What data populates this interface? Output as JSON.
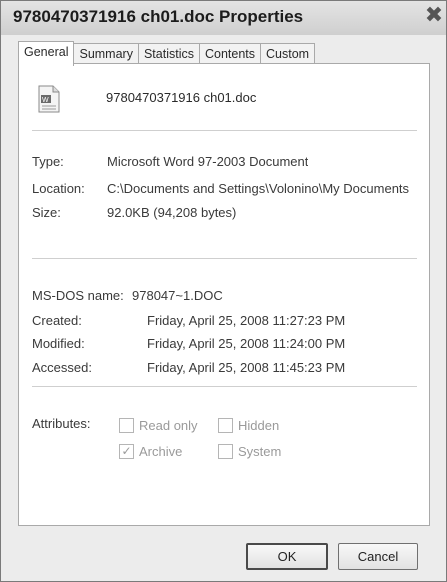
{
  "window": {
    "title": "9780470371916 ch01.doc Properties",
    "close_glyph": "✖"
  },
  "tabs": [
    {
      "label": "General",
      "active": true
    },
    {
      "label": "Summary",
      "active": false
    },
    {
      "label": "Statistics",
      "active": false
    },
    {
      "label": "Contents",
      "active": false
    },
    {
      "label": "Custom",
      "active": false
    }
  ],
  "file": {
    "name": "9780470371916 ch01.doc",
    "icon": "word-document-icon"
  },
  "info": {
    "type_label": "Type:",
    "type_value": "Microsoft Word 97-2003 Document",
    "location_label": "Location:",
    "location_value": "C:\\Documents and Settings\\Volonino\\My Documents",
    "size_label": "Size:",
    "size_value": "92.0KB (94,208 bytes)"
  },
  "dates": {
    "msdos_label": "MS-DOS name:",
    "msdos_value": "978047~1.DOC",
    "created_label": "Created:",
    "created_value": "Friday, April 25, 2008 11:27:23 PM",
    "modified_label": "Modified:",
    "modified_value": "Friday, April 25, 2008 11:24:00 PM",
    "accessed_label": "Accessed:",
    "accessed_value": "Friday, April 25, 2008 11:45:23 PM"
  },
  "attributes": {
    "label": "Attributes:",
    "read_only": {
      "label": "Read only",
      "checked": false
    },
    "hidden": {
      "label": "Hidden",
      "checked": false
    },
    "archive": {
      "label": "Archive",
      "checked": true
    },
    "system": {
      "label": "System",
      "checked": false
    }
  },
  "buttons": {
    "ok": "OK",
    "cancel": "Cancel"
  }
}
